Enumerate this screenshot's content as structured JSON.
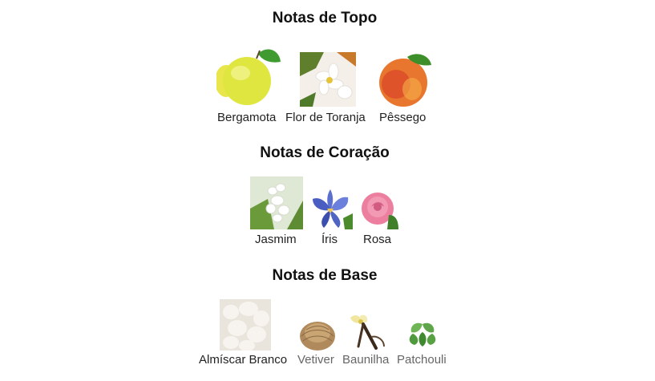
{
  "sections": [
    {
      "title": "Notas de Topo",
      "notes": [
        {
          "label": "Bergamota",
          "icon": "bergamot-icon"
        },
        {
          "label": "Flor de Toranja",
          "icon": "grapefruit-blossom-icon"
        },
        {
          "label": "Pêssego",
          "icon": "peach-icon"
        }
      ]
    },
    {
      "title": "Notas de Coração",
      "notes": [
        {
          "label": "Jasmim",
          "icon": "jasmine-icon"
        },
        {
          "label": "Íris",
          "icon": "iris-icon"
        },
        {
          "label": "Rosa",
          "icon": "rose-icon"
        }
      ]
    },
    {
      "title": "Notas de Base",
      "notes": [
        {
          "label": "Almíscar Branco",
          "icon": "white-musk-icon"
        },
        {
          "label": "Vetiver",
          "icon": "vetiver-icon"
        },
        {
          "label": "Baunilha",
          "icon": "vanilla-icon"
        },
        {
          "label": "Patchouli",
          "icon": "patchouli-icon"
        }
      ]
    }
  ]
}
